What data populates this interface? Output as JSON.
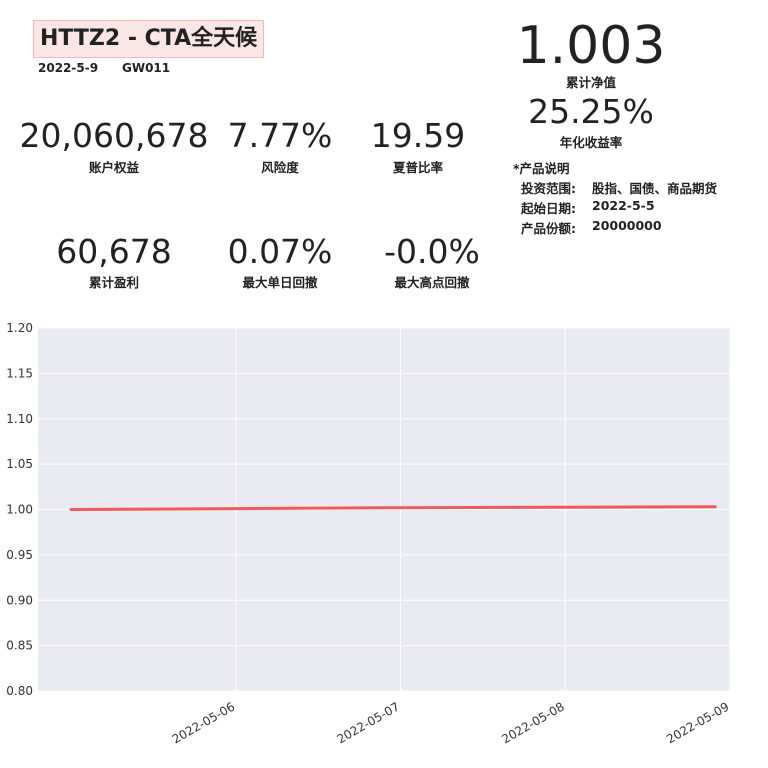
{
  "header": {
    "title": "HTTZ2 - CTA全天候",
    "date": "2022-5-9",
    "code": "GW011"
  },
  "nav": {
    "value": "1.003",
    "label": "累计净值",
    "annual_return": "25.25%",
    "annual_return_label": "年化收益率"
  },
  "metrics": [
    {
      "value": "20,060,678",
      "label": "账户权益"
    },
    {
      "value": "7.77%",
      "label": "风险度"
    },
    {
      "value": "19.59",
      "label": "夏普比率"
    },
    {
      "value": "60,678",
      "label": "累计盈利"
    },
    {
      "value": "0.07%",
      "label": "最大单日回撤"
    },
    {
      "value": "-0.0%",
      "label": "最大高点回撤"
    }
  ],
  "product": {
    "heading": "*产品说明",
    "rows": [
      {
        "key": "投资范围:",
        "value": "股指、国债、商品期货"
      },
      {
        "key": "起始日期:",
        "value": "2022-5-5"
      },
      {
        "key": "产品份额:",
        "value": "20000000"
      }
    ]
  },
  "colors": {
    "line": "#f05a5a",
    "plot_bg": "#eaeaf2",
    "grid": "#ffffff"
  },
  "chart_data": {
    "type": "line",
    "title": "",
    "xlabel": "",
    "ylabel": "",
    "x": [
      "2022-05-05",
      "2022-05-06",
      "2022-05-07",
      "2022-05-08",
      "2022-05-09"
    ],
    "y": [
      1.0,
      1.001,
      1.002,
      1.0025,
      1.003
    ],
    "ylim": [
      0.8,
      1.2
    ],
    "yticks": [
      "0.80",
      "0.85",
      "0.90",
      "0.95",
      "1.00",
      "1.05",
      "1.10",
      "1.15",
      "1.20"
    ],
    "xticks": [
      "2022-05-06",
      "2022-05-07",
      "2022-05-08",
      "2022-05-09"
    ],
    "grid": true,
    "legend": "none"
  }
}
